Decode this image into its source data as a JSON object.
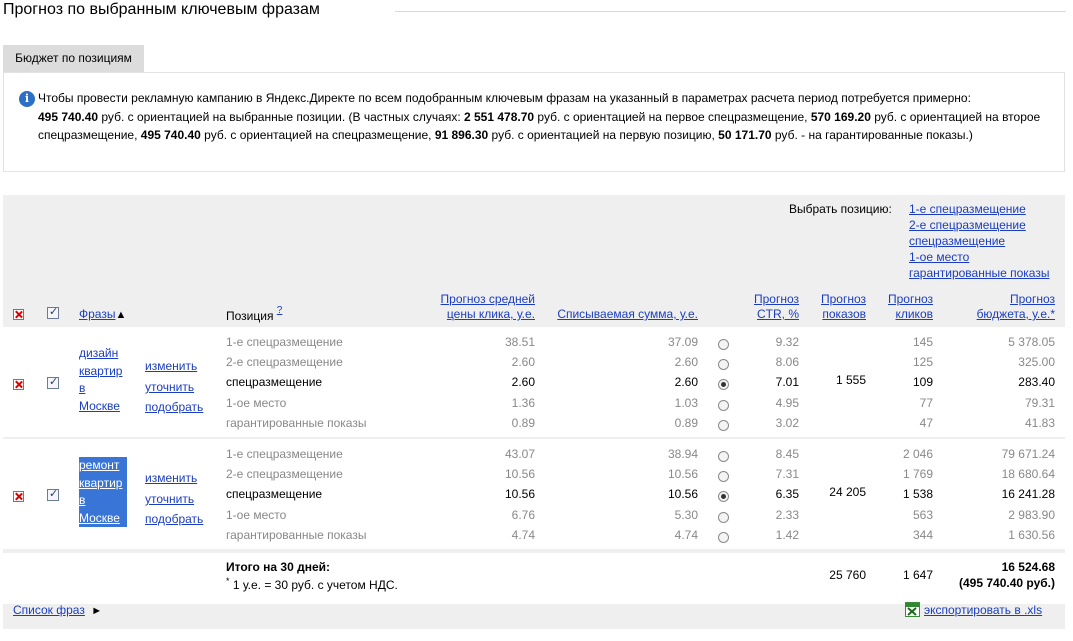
{
  "page": {
    "title": "Прогноз по выбранным ключевым фразам"
  },
  "tab": {
    "label": "Бюджет по позициям"
  },
  "info": {
    "p1": "Чтобы провести рекламную кампанию в Яндекс.Директе по всем подобранным ключевым фразам на указанный в параметрах расчета период потребуется примерно:",
    "b1": "495 740.40",
    "p2": " руб. с ориентацией на выбранные позиции. (В частных случаях: ",
    "b2": "2 551 478.70",
    "p3": " руб. с ориентацией на первое спецразмещение, ",
    "b3": "570 169.20",
    "p4": " руб. с ориентацией на второе спецразмещение, ",
    "b4": "495 740.40",
    "p5": " руб. с ориентацией на спецразмещение, ",
    "b5": "91 896.30",
    "p6": " руб. с ориентацией на первую позицию, ",
    "b6": "50 171.70",
    "p7": " руб. - на гарантированные показы.)"
  },
  "choose": {
    "label": "Выбрать позицию:",
    "options": [
      "1-е спецразмещение",
      "2-е спецразмещение",
      "спецразмещение",
      "1-ое место",
      "гарантированные показы"
    ]
  },
  "headers": {
    "phrases": "Фразы",
    "sort_arrow": "▲",
    "position": "Позиция",
    "position_help": "?",
    "avg_price_1": "Прогноз средней",
    "avg_price_2": "цены клика, у.е.",
    "spend": "Списываемая сумма, у.е.",
    "ctr_1": "Прогноз",
    "ctr_2": "CTR, %",
    "shows_1": "Прогноз",
    "shows_2": "показов",
    "clicks_1": "Прогноз",
    "clicks_2": "кликов",
    "budget_1": "Прогноз",
    "budget_2": "бюджета, у.е.*"
  },
  "actions": {
    "edit": "изменить",
    "refine": "уточнить",
    "pick": "подобрать"
  },
  "phrases": [
    {
      "lines": [
        "дизайн",
        "квартир",
        "в",
        "Москве"
      ],
      "shows": "1 555",
      "rows": [
        {
          "position": "1-е спецразмещение",
          "price": "38.51",
          "spend": "37.09",
          "ctr": "9.32",
          "clicks": "145",
          "budget": "5 378.05"
        },
        {
          "position": "2-е спецразмещение",
          "price": "2.60",
          "spend": "2.60",
          "ctr": "8.06",
          "clicks": "125",
          "budget": "325.00"
        },
        {
          "position": "спецразмещение",
          "price": "2.60",
          "spend": "2.60",
          "ctr": "7.01",
          "clicks": "109",
          "budget": "283.40"
        },
        {
          "position": "1-ое место",
          "price": "1.36",
          "spend": "1.03",
          "ctr": "4.95",
          "clicks": "77",
          "budget": "79.31"
        },
        {
          "position": "гарантированные показы",
          "price": "0.89",
          "spend": "0.89",
          "ctr": "3.02",
          "clicks": "47",
          "budget": "41.83"
        }
      ]
    },
    {
      "lines": [
        "ремонт",
        "квартир",
        "в",
        "Москве"
      ],
      "shows": "24 205",
      "rows": [
        {
          "position": "1-е спецразмещение",
          "price": "43.07",
          "spend": "38.94",
          "ctr": "8.45",
          "clicks": "2 046",
          "budget": "79 671.24"
        },
        {
          "position": "2-е спецразмещение",
          "price": "10.56",
          "spend": "10.56",
          "ctr": "7.31",
          "clicks": "1 769",
          "budget": "18 680.64"
        },
        {
          "position": "спецразмещение",
          "price": "10.56",
          "spend": "10.56",
          "ctr": "6.35",
          "clicks": "1 538",
          "budget": "16 241.28"
        },
        {
          "position": "1-ое место",
          "price": "6.76",
          "spend": "5.30",
          "ctr": "2.33",
          "clicks": "563",
          "budget": "2 983.90"
        },
        {
          "position": "гарантированные показы",
          "price": "4.74",
          "spend": "4.74",
          "ctr": "1.42",
          "clicks": "344",
          "budget": "1 630.56"
        }
      ]
    }
  ],
  "totals": {
    "label": "Итого на 30 дней:",
    "note_star": "*",
    "note": " 1 у.е. = 30 руб. с учетом НДС.",
    "shows": "25 760",
    "clicks": "1 647",
    "budget": "16 524.68",
    "budget_rub": "(495 740.40 руб.)"
  },
  "footer": {
    "list": "Список фраз",
    "list_arrow": "►",
    "export": "экспортировать в .xls"
  }
}
